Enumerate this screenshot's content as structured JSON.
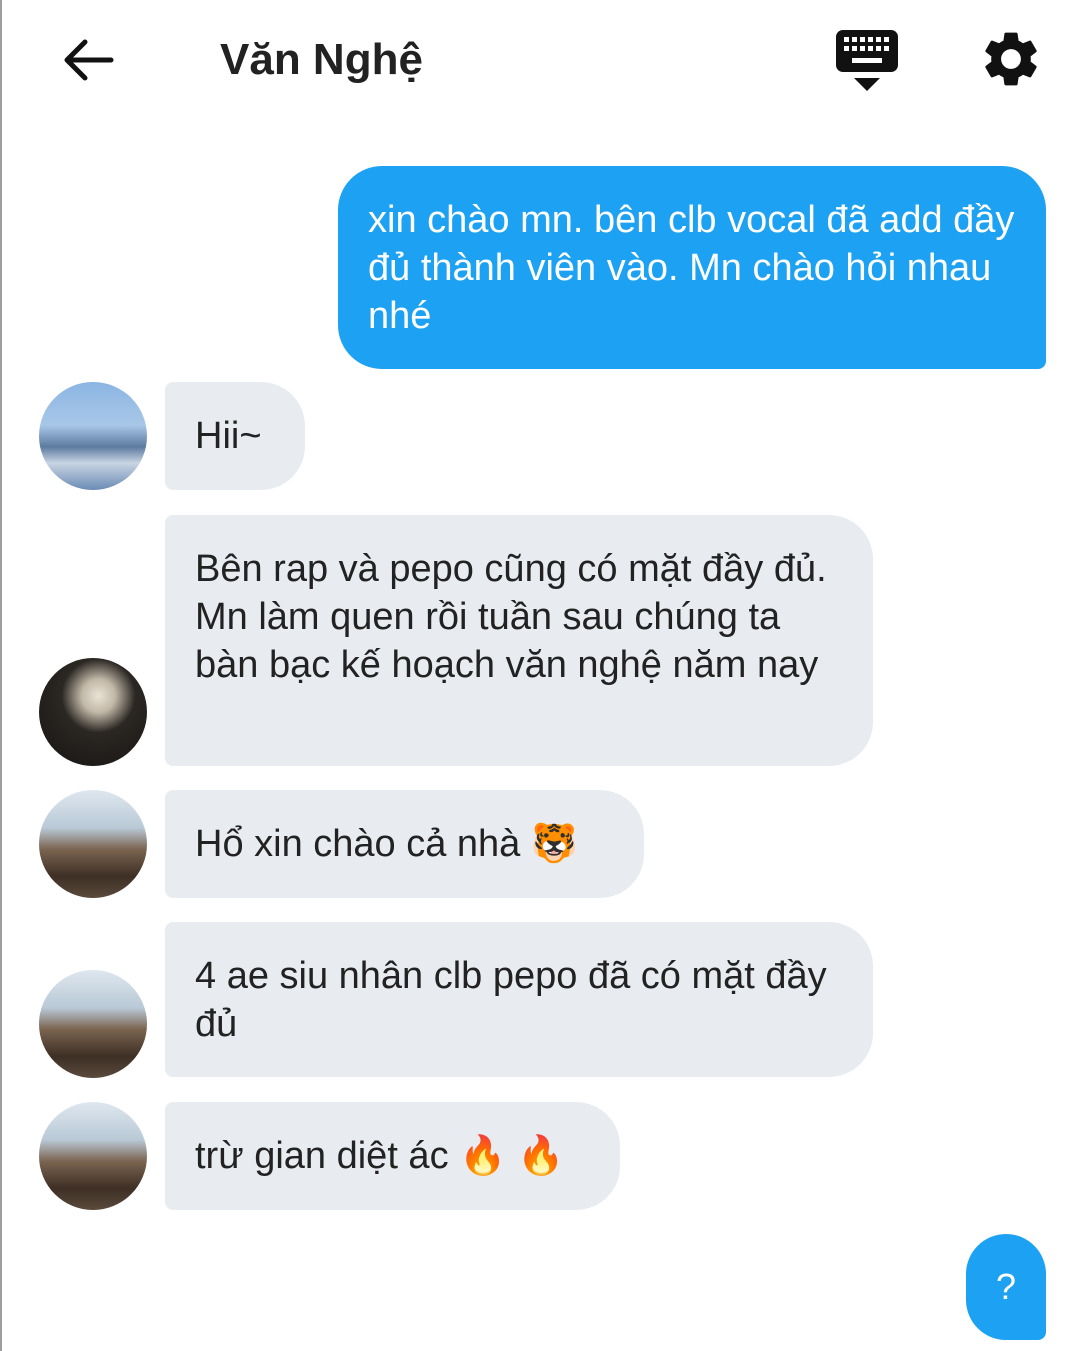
{
  "header": {
    "title": "Văn Nghệ"
  },
  "messages": {
    "m1": "xin chào mn. bên clb vocal đã add đầy đủ thành viên vào. Mn chào hỏi nhau nhé",
    "m2": "Hii~",
    "m3": "Bên rap và pepo cũng có mặt đầy đủ. Mn làm quen rồi tuần sau chúng ta bàn bạc kế hoạch văn nghệ năm nay",
    "m4": "Hổ xin chào cả nhà 🐯",
    "m5": "4 ae siu nhân clb pepo đã có mặt đầy đủ",
    "m6": "trừ gian diệt ác 🔥 🔥"
  },
  "help": {
    "label": "?"
  },
  "colors": {
    "outgoing_bubble": "#1da1f2",
    "incoming_bubble": "#e8ebef"
  },
  "icons": {
    "back": "arrow-left-icon",
    "keyboard": "keyboard-icon",
    "settings": "gear-icon"
  }
}
